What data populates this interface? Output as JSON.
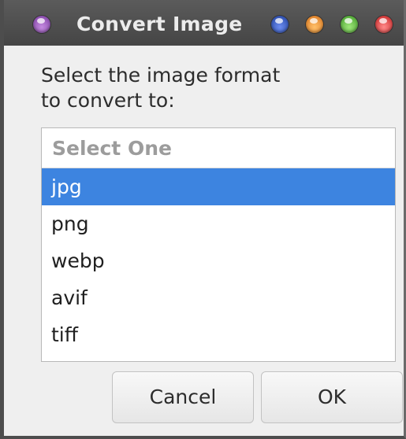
{
  "window": {
    "title": "Convert Image"
  },
  "dialog": {
    "prompt": "Select the image format\nto convert to:",
    "list": {
      "header": "Select One",
      "items": [
        {
          "label": "jpg",
          "selected": true
        },
        {
          "label": "png",
          "selected": false
        },
        {
          "label": "webp",
          "selected": false
        },
        {
          "label": "avif",
          "selected": false
        },
        {
          "label": "tiff",
          "selected": false
        }
      ]
    },
    "buttons": {
      "cancel": "Cancel",
      "ok": "OK"
    }
  },
  "colors": {
    "selection": "#3d84e0",
    "titlebar": "#4d4d4d",
    "dialog_bg": "#efefef"
  },
  "icons": {
    "menu": "purple-orb-icon",
    "controls": [
      "blue-orb-icon",
      "orange-orb-icon",
      "green-orb-icon",
      "red-orb-icon"
    ]
  }
}
